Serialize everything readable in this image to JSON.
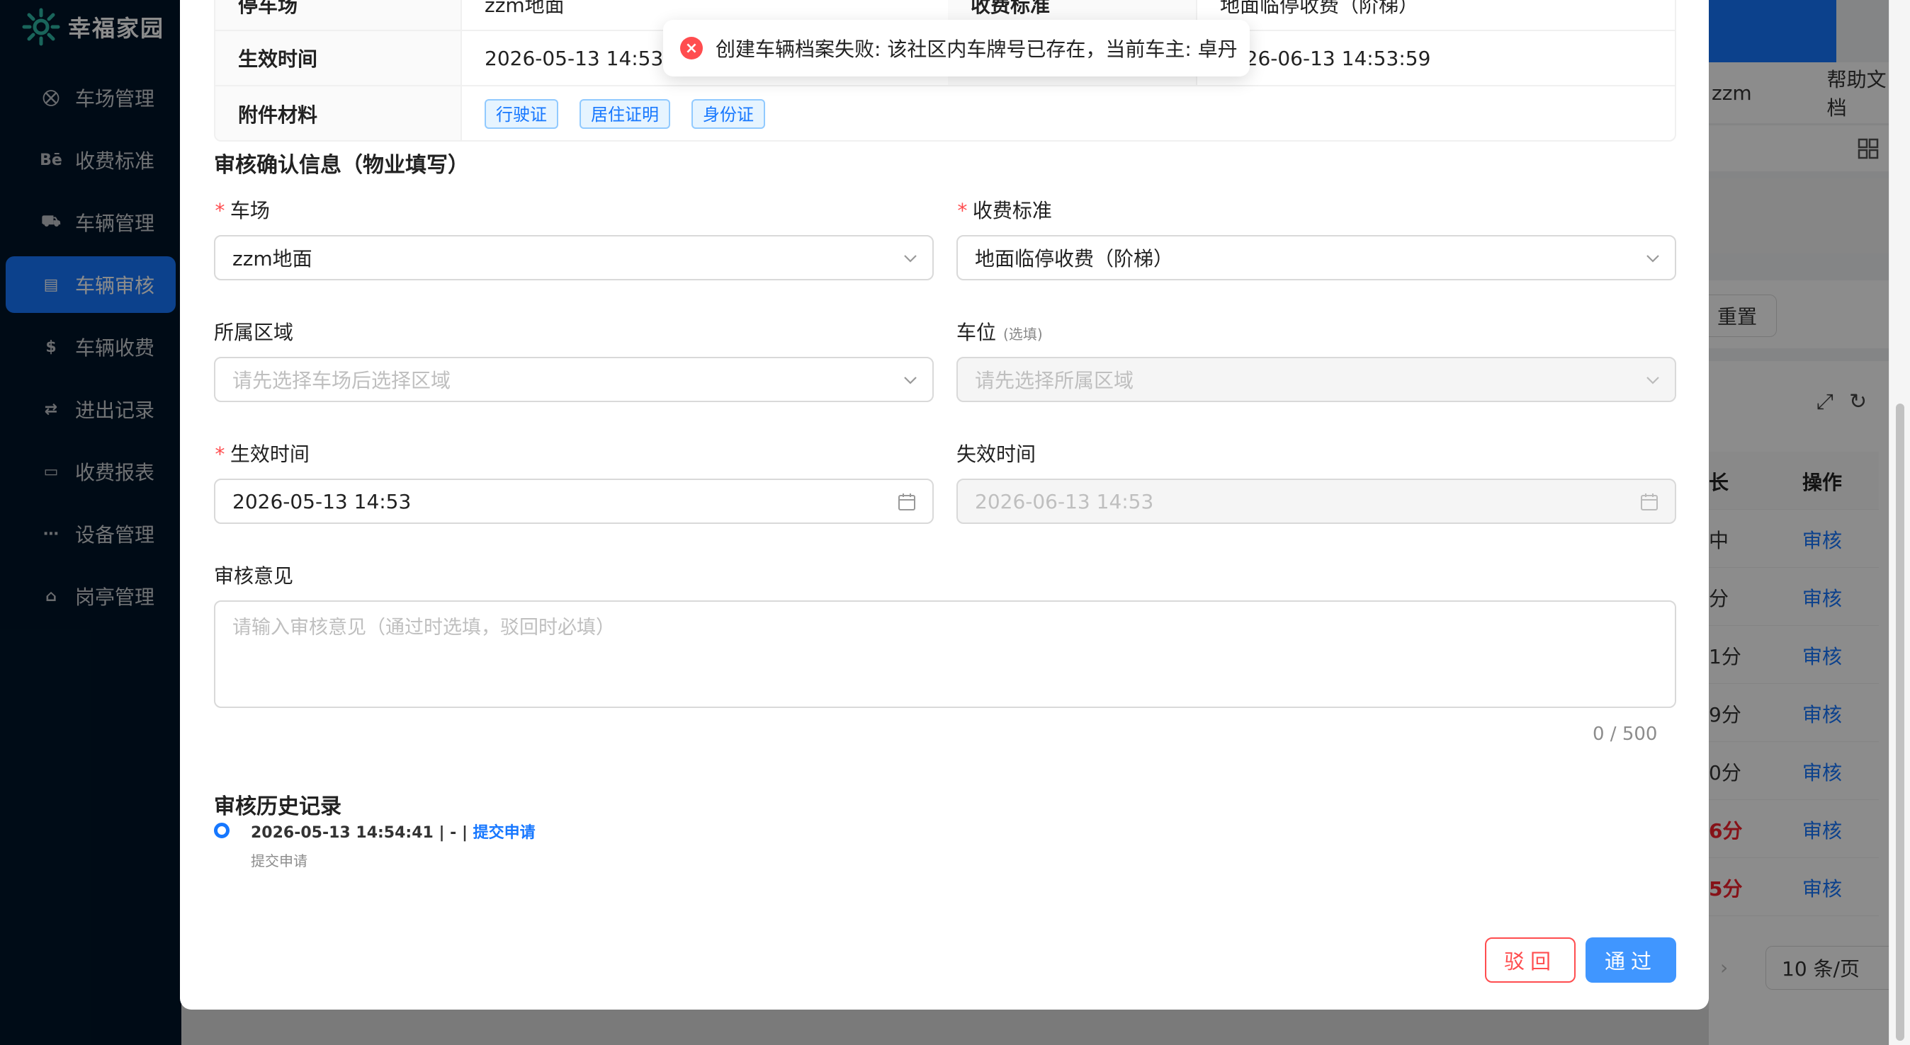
{
  "app": {
    "name": "幸福家园"
  },
  "sidebar": {
    "items": [
      {
        "label": "车场管理",
        "icon": "parking-icon",
        "glyph": "⛒"
      },
      {
        "label": "收费标准",
        "icon": "behance-icon",
        "glyph": "Bē"
      },
      {
        "label": "车辆管理",
        "icon": "car-icon",
        "glyph": "⛟"
      },
      {
        "label": "车辆审核",
        "icon": "audit-icon",
        "glyph": "▤",
        "active": true
      },
      {
        "label": "车辆收费",
        "icon": "dollar-icon",
        "glyph": "$"
      },
      {
        "label": "进出记录",
        "icon": "entry-log-icon",
        "glyph": "⇄"
      },
      {
        "label": "收费报表",
        "icon": "report-icon",
        "glyph": "▭"
      },
      {
        "label": "设备管理",
        "icon": "device-icon",
        "glyph": "⋯"
      },
      {
        "label": "岗亭管理",
        "icon": "booth-icon",
        "glyph": "⌂"
      }
    ]
  },
  "background": {
    "header": {
      "user": "zzm",
      "help": "帮助文档"
    },
    "reset_label": "重置",
    "table": {
      "col_duration": "长",
      "col_action": "操作",
      "rows": [
        {
          "duration": "中",
          "action": "审核",
          "highlight": false
        },
        {
          "duration": "分",
          "action": "审核",
          "highlight": false
        },
        {
          "duration": "1分",
          "action": "审核",
          "highlight": false
        },
        {
          "duration": "9分",
          "action": "审核",
          "highlight": false
        },
        {
          "duration": "0分",
          "action": "审核",
          "highlight": false
        },
        {
          "duration": "6分",
          "action": "审核",
          "highlight": true
        },
        {
          "duration": "5分",
          "action": "审核",
          "highlight": true
        }
      ]
    },
    "page_size": "10 条/页"
  },
  "toast": {
    "type": "error",
    "message": "创建车辆档案失败: 该社区内车牌号已存在，当前车主: 卓丹"
  },
  "modal": {
    "details": {
      "row1": {
        "label1": "停车场",
        "value1": "zzm地面",
        "label2": "收费标准",
        "value2": "地面临停收费（阶梯）"
      },
      "row2": {
        "label1": "生效时间",
        "value1": "2026-05-13 14:53:59",
        "value2": "2026-06-13 14:53:59"
      },
      "row3": {
        "label": "附件材料",
        "tags": [
          "行驶证",
          "居住证明",
          "身份证"
        ]
      }
    },
    "form": {
      "title": "审核确认信息（物业填写）",
      "parking_lot": {
        "label": "车场",
        "value": "zzm地面"
      },
      "fee_standard": {
        "label": "收费标准",
        "value": "地面临停收费（阶梯）"
      },
      "area": {
        "label": "所属区域",
        "placeholder": "请先选择车场后选择区域"
      },
      "space": {
        "label": "车位",
        "optional": "(选填)",
        "placeholder": "请先选择所属区域"
      },
      "effective": {
        "label": "生效时间",
        "value": "2026-05-13 14:53"
      },
      "expire": {
        "label": "失效时间",
        "value": "2026-06-13 14:53"
      },
      "opinion": {
        "label": "审核意见",
        "placeholder": "请输入审核意见（通过时选填，驳回时必填）",
        "counter": "0 / 500"
      }
    },
    "history": {
      "title": "审核历史记录",
      "items": [
        {
          "time": "2026-05-13 14:54:41",
          "meta": " | - | ",
          "action": "提交申请",
          "note": "提交申请"
        }
      ]
    },
    "buttons": {
      "reject": "驳回",
      "pass": "通过"
    }
  }
}
